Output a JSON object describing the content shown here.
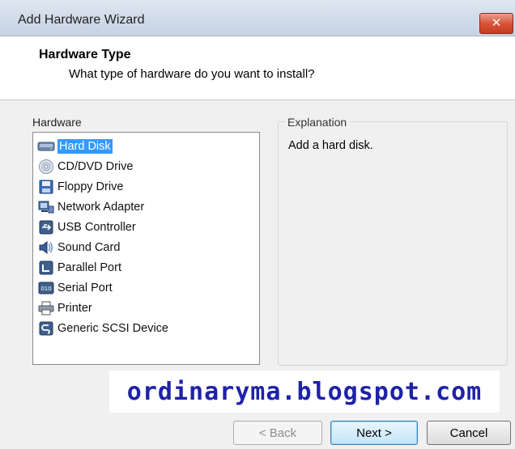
{
  "window": {
    "title": "Add Hardware Wizard",
    "close_label": "✕"
  },
  "header": {
    "title": "Hardware Type",
    "subtitle": "What type of hardware do you want to install?"
  },
  "hardware_list": {
    "label": "Hardware",
    "selected_index": 0,
    "items": [
      {
        "label": "Hard Disk",
        "icon": "hard-disk-icon"
      },
      {
        "label": "CD/DVD Drive",
        "icon": "cd-dvd-icon"
      },
      {
        "label": "Floppy Drive",
        "icon": "floppy-icon"
      },
      {
        "label": "Network Adapter",
        "icon": "network-adapter-icon"
      },
      {
        "label": "USB Controller",
        "icon": "usb-icon"
      },
      {
        "label": "Sound Card",
        "icon": "sound-icon"
      },
      {
        "label": "Parallel Port",
        "icon": "parallel-port-icon"
      },
      {
        "label": "Serial Port",
        "icon": "serial-port-icon"
      },
      {
        "label": "Printer",
        "icon": "printer-icon"
      },
      {
        "label": "Generic SCSI Device",
        "icon": "scsi-icon"
      }
    ]
  },
  "explanation": {
    "label": "Explanation",
    "text": "Add a hard disk."
  },
  "watermark": "ordinaryma.blogspot.com",
  "buttons": {
    "back": "< Back",
    "next": "Next >",
    "cancel": "Cancel"
  },
  "colors": {
    "selection": "#3399ff",
    "watermark": "#1f22a8",
    "close": "#c63c22"
  }
}
